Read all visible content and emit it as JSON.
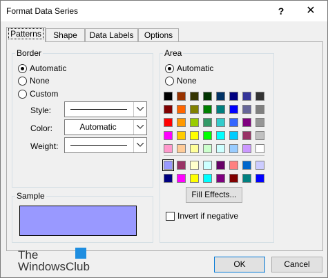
{
  "window": {
    "title": "Format Data Series",
    "help_glyph": "?",
    "close_glyph": "✕"
  },
  "tabs": [
    {
      "label": "Patterns"
    },
    {
      "label": "Shape"
    },
    {
      "label": "Data Labels"
    },
    {
      "label": "Options"
    }
  ],
  "border": {
    "title": "Border",
    "options": [
      {
        "label": "Automatic",
        "selected": true
      },
      {
        "label": "None",
        "selected": false
      },
      {
        "label": "Custom",
        "selected": false
      }
    ],
    "style_label": "Style:",
    "color_label": "Color:",
    "color_value": "Automatic",
    "weight_label": "Weight:"
  },
  "sample": {
    "title": "Sample",
    "color": "#9999ff"
  },
  "area": {
    "title": "Area",
    "options": [
      {
        "label": "Automatic",
        "selected": true
      },
      {
        "label": "None",
        "selected": false
      }
    ],
    "palette_main": [
      [
        "#000000",
        "#993300",
        "#333300",
        "#003300",
        "#003366",
        "#000080",
        "#333399",
        "#333333"
      ],
      [
        "#800000",
        "#ff6600",
        "#808000",
        "#008000",
        "#008080",
        "#0000ff",
        "#666699",
        "#808080"
      ],
      [
        "#ff0000",
        "#ff9900",
        "#99cc00",
        "#339966",
        "#33cccc",
        "#3366ff",
        "#800080",
        "#969696"
      ],
      [
        "#ff00ff",
        "#ffcc00",
        "#ffff00",
        "#00ff00",
        "#00ffff",
        "#00ccff",
        "#993366",
        "#c0c0c0"
      ],
      [
        "#ff99cc",
        "#ffcc99",
        "#ffff99",
        "#ccffcc",
        "#ccffff",
        "#99ccff",
        "#cc99ff",
        "#ffffff"
      ]
    ],
    "palette_extra": [
      [
        "#9999ff",
        "#993366",
        "#ffffcc",
        "#ccffff",
        "#660066",
        "#ff8080",
        "#0066cc",
        "#ccccff"
      ],
      [
        "#000080",
        "#ff00ff",
        "#ffff00",
        "#00ffff",
        "#800080",
        "#800000",
        "#008080",
        "#0000ff"
      ]
    ],
    "selected_color": "#9999ff",
    "fill_effects_label": "Fill Effects...",
    "invert_label": "Invert if negative"
  },
  "footer": {
    "ok_label": "OK",
    "cancel_label": "Cancel",
    "logo_line1": "The",
    "logo_line2": "WindowsClub"
  }
}
